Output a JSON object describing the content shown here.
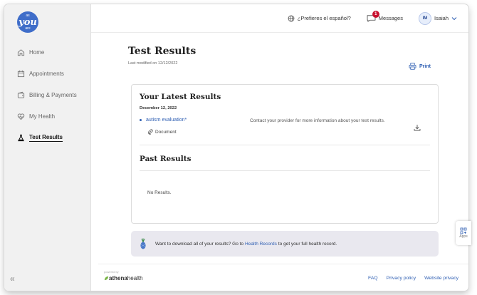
{
  "brand": {
    "logo_top": "as",
    "logo_main": "you",
    "logo_bottom": "are"
  },
  "sidebar": {
    "items": [
      {
        "label": "Home",
        "icon": "home-icon"
      },
      {
        "label": "Appointments",
        "icon": "calendar-icon"
      },
      {
        "label": "Billing & Payments",
        "icon": "wallet-icon"
      },
      {
        "label": "My Health",
        "icon": "heart-icon"
      },
      {
        "label": "Test Results",
        "icon": "flask-icon",
        "active": true
      }
    ],
    "collapse_label": "«"
  },
  "topbar": {
    "language": "¿Prefieres el español?",
    "messages": "Messages",
    "messages_count": "1",
    "user_initials": "IM",
    "user_name": "Isaiah"
  },
  "page": {
    "title": "Test Results",
    "modified": "Last modified on 12/12/2022",
    "print": "Print"
  },
  "latest": {
    "heading": "Your Latest Results",
    "date": "December 12, 2022",
    "result_name": "autism evaluation*",
    "result_type": "Document",
    "message": "Contact your provider for more information about your test results."
  },
  "past": {
    "heading": "Past Results",
    "empty": "No Results."
  },
  "banner": {
    "text_before": "Want to download all of your results? Go to",
    "link": "Health Records",
    "text_after": "to get your full health record."
  },
  "footer": {
    "powered_by": "powered by",
    "athena_a": "athena",
    "athena_b": "health",
    "links": [
      "FAQ",
      "Privacy policy",
      "Website privacy"
    ]
  },
  "apps": {
    "label": "Apps"
  },
  "colors": {
    "accent": "#2f5fb3",
    "logo": "#3f6dc9",
    "badge": "#c8102e"
  }
}
